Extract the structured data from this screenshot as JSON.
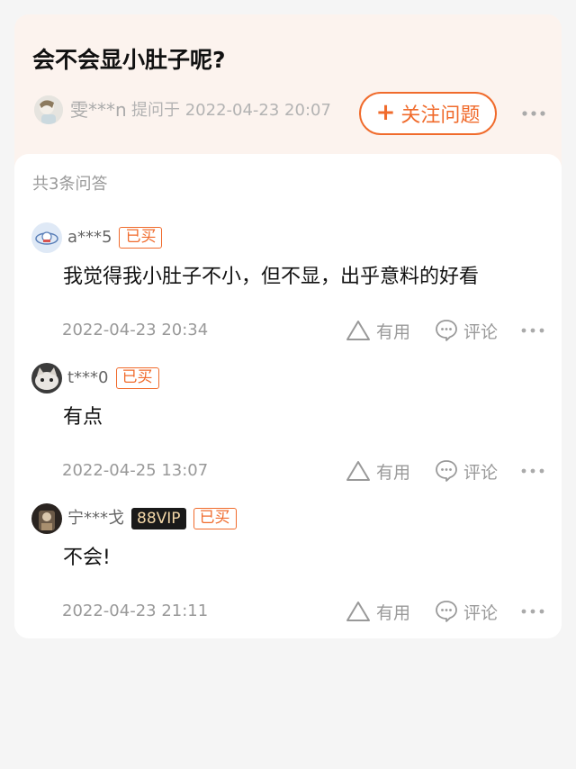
{
  "question": {
    "title": "会不会显小肚子呢?",
    "asker_name": "雯***n",
    "asker_meta": "提问于 2022-04-23 20:07",
    "follow_plus": "+",
    "follow_label": "关注问题"
  },
  "answers_header": {
    "count_label": "共3条问答"
  },
  "answers": [
    {
      "user": "a***5",
      "vip": "",
      "bought": "已买",
      "text": "我觉得我小肚子不小，但不显，出乎意料的好看",
      "date": "2022-04-23 20:34",
      "useful_label": "有用",
      "comment_label": "评论"
    },
    {
      "user": "t***0",
      "vip": "",
      "bought": "已买",
      "text": "有点",
      "date": "2022-04-25 13:07",
      "useful_label": "有用",
      "comment_label": "评论"
    },
    {
      "user": "宁***戈",
      "vip": "88VIP",
      "bought": "已买",
      "text": "不会!",
      "date": "2022-04-23 21:11",
      "useful_label": "有用",
      "comment_label": "评论"
    }
  ],
  "colors": {
    "accent": "#f06b2c",
    "question_card_bg": "#fcf3ee",
    "page_bg": "#f5f5f5",
    "vip_bg": "#1a1a1a",
    "vip_text": "#f3d7a8"
  },
  "icons": [
    "avatar",
    "plus-icon",
    "more-dots-icon",
    "thumb-triangle-icon",
    "comment-bubble-icon"
  ]
}
